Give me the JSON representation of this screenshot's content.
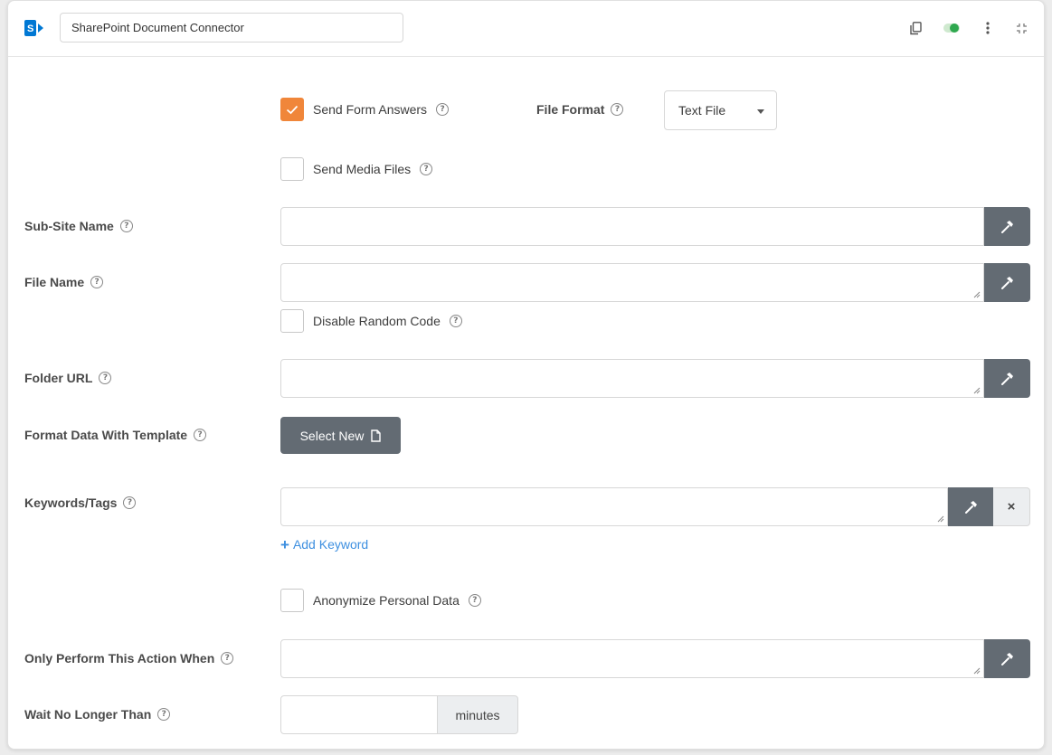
{
  "header": {
    "title": "SharePoint Document Connector",
    "icons": [
      "sharepoint-icon",
      "copy-icon",
      "toggle-icon",
      "more-vertical-icon",
      "collapse-icon"
    ],
    "logo_color": "#0078d4",
    "toggle_color": "#2fa84f"
  },
  "form": {
    "send_form_answers": {
      "label": "Send Form Answers",
      "checked": true
    },
    "file_format": {
      "label": "File Format",
      "selected": "Text File"
    },
    "send_media_files": {
      "label": "Send Media Files",
      "checked": false
    },
    "sub_site_name": {
      "label": "Sub-Site Name",
      "value": ""
    },
    "file_name": {
      "label": "File Name",
      "value": ""
    },
    "disable_random_code": {
      "label": "Disable Random Code",
      "checked": false
    },
    "folder_url": {
      "label": "Folder URL",
      "value": ""
    },
    "format_template": {
      "label": "Format Data With Template",
      "button": "Select New"
    },
    "keywords": {
      "label": "Keywords/Tags",
      "value": "",
      "add_label": "Add Keyword",
      "remove_label": "×"
    },
    "anonymize": {
      "label": "Anonymize Personal Data",
      "checked": false
    },
    "only_perform": {
      "label": "Only Perform This Action When",
      "value": ""
    },
    "wait": {
      "label": "Wait No Longer Than",
      "value": "",
      "unit": "minutes"
    }
  },
  "colors": {
    "accent_orange": "#f0863a",
    "button_gray": "#636b73",
    "link_blue": "#3d8fe0"
  }
}
